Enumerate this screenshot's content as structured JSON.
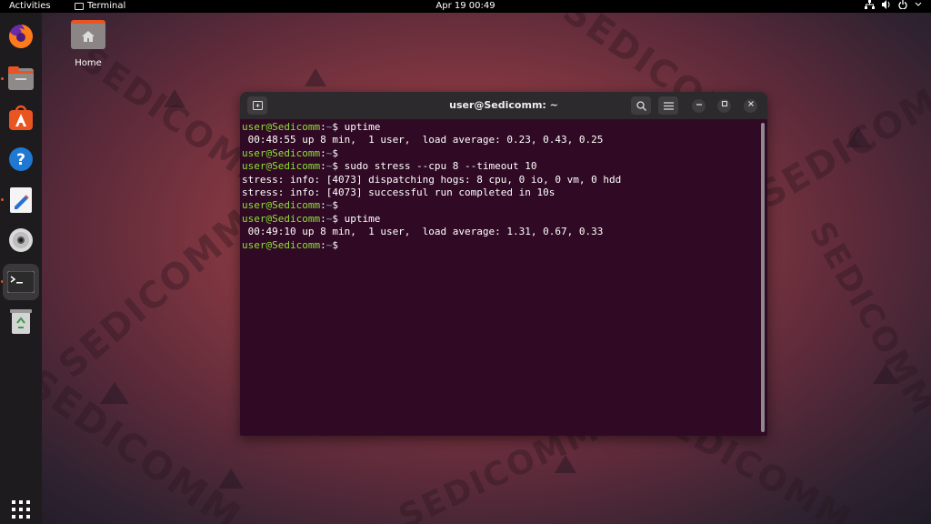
{
  "topbar": {
    "activities": "Activities",
    "app_name": "Terminal",
    "clock": "Apr 19  00:49"
  },
  "desktop": {
    "home_label": "Home",
    "watermark": "SEDICOMM"
  },
  "terminal": {
    "title": "user@Sedicomm: ~",
    "prompt_user": "user@Sedicomm",
    "prompt_path": "~",
    "lines": [
      {
        "prompt": true,
        "cmd": "uptime"
      },
      {
        "prompt": false,
        "text": " 00:48:55 up 8 min,  1 user,  load average: 0.23, 0.43, 0.25"
      },
      {
        "prompt": true,
        "cmd": ""
      },
      {
        "prompt": true,
        "cmd": "sudo stress --cpu 8 --timeout 10"
      },
      {
        "prompt": false,
        "text": "stress: info: [4073] dispatching hogs: 8 cpu, 0 io, 0 vm, 0 hdd"
      },
      {
        "prompt": false,
        "text": "stress: info: [4073] successful run completed in 10s"
      },
      {
        "prompt": true,
        "cmd": ""
      },
      {
        "prompt": true,
        "cmd": "uptime"
      },
      {
        "prompt": false,
        "text": " 00:49:10 up 8 min,  1 user,  load average: 1.31, 0.67, 0.33"
      },
      {
        "prompt": true,
        "cmd": ""
      }
    ]
  },
  "dock": {
    "items": [
      "firefox-icon",
      "files-icon",
      "software-icon",
      "help-icon",
      "text-editor-icon",
      "disc-icon",
      "terminal-icon",
      "trash-icon",
      "app-grid-icon"
    ]
  },
  "colors": {
    "terminal_bg": "#300a24",
    "prompt_user": "#8ae234",
    "prompt_path": "#729fcf",
    "accent": "#e95420"
  }
}
